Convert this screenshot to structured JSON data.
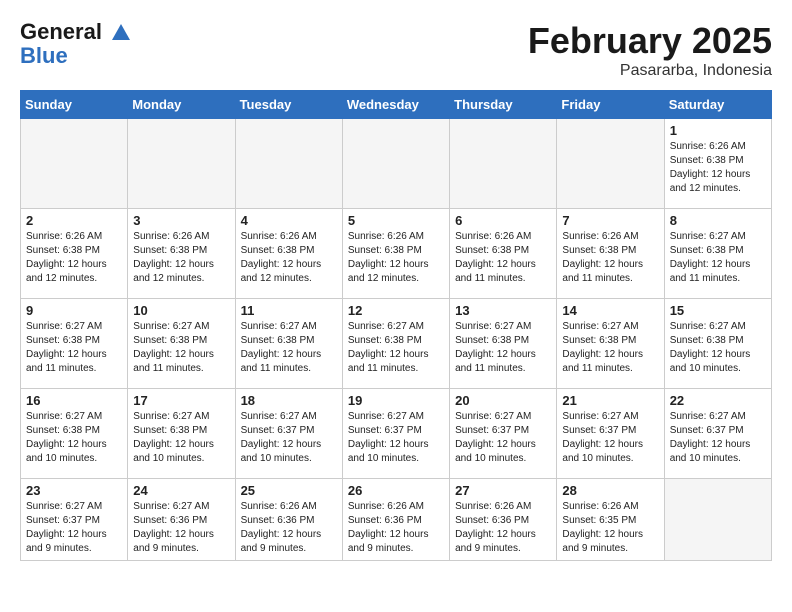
{
  "logo": {
    "line1": "General",
    "line2": "Blue"
  },
  "title": "February 2025",
  "subtitle": "Pasararba, Indonesia",
  "days_of_week": [
    "Sunday",
    "Monday",
    "Tuesday",
    "Wednesday",
    "Thursday",
    "Friday",
    "Saturday"
  ],
  "weeks": [
    [
      {
        "day": "",
        "info": ""
      },
      {
        "day": "",
        "info": ""
      },
      {
        "day": "",
        "info": ""
      },
      {
        "day": "",
        "info": ""
      },
      {
        "day": "",
        "info": ""
      },
      {
        "day": "",
        "info": ""
      },
      {
        "day": "1",
        "info": "Sunrise: 6:26 AM\nSunset: 6:38 PM\nDaylight: 12 hours\nand 12 minutes."
      }
    ],
    [
      {
        "day": "2",
        "info": "Sunrise: 6:26 AM\nSunset: 6:38 PM\nDaylight: 12 hours\nand 12 minutes."
      },
      {
        "day": "3",
        "info": "Sunrise: 6:26 AM\nSunset: 6:38 PM\nDaylight: 12 hours\nand 12 minutes."
      },
      {
        "day": "4",
        "info": "Sunrise: 6:26 AM\nSunset: 6:38 PM\nDaylight: 12 hours\nand 12 minutes."
      },
      {
        "day": "5",
        "info": "Sunrise: 6:26 AM\nSunset: 6:38 PM\nDaylight: 12 hours\nand 12 minutes."
      },
      {
        "day": "6",
        "info": "Sunrise: 6:26 AM\nSunset: 6:38 PM\nDaylight: 12 hours\nand 11 minutes."
      },
      {
        "day": "7",
        "info": "Sunrise: 6:26 AM\nSunset: 6:38 PM\nDaylight: 12 hours\nand 11 minutes."
      },
      {
        "day": "8",
        "info": "Sunrise: 6:27 AM\nSunset: 6:38 PM\nDaylight: 12 hours\nand 11 minutes."
      }
    ],
    [
      {
        "day": "9",
        "info": "Sunrise: 6:27 AM\nSunset: 6:38 PM\nDaylight: 12 hours\nand 11 minutes."
      },
      {
        "day": "10",
        "info": "Sunrise: 6:27 AM\nSunset: 6:38 PM\nDaylight: 12 hours\nand 11 minutes."
      },
      {
        "day": "11",
        "info": "Sunrise: 6:27 AM\nSunset: 6:38 PM\nDaylight: 12 hours\nand 11 minutes."
      },
      {
        "day": "12",
        "info": "Sunrise: 6:27 AM\nSunset: 6:38 PM\nDaylight: 12 hours\nand 11 minutes."
      },
      {
        "day": "13",
        "info": "Sunrise: 6:27 AM\nSunset: 6:38 PM\nDaylight: 12 hours\nand 11 minutes."
      },
      {
        "day": "14",
        "info": "Sunrise: 6:27 AM\nSunset: 6:38 PM\nDaylight: 12 hours\nand 11 minutes."
      },
      {
        "day": "15",
        "info": "Sunrise: 6:27 AM\nSunset: 6:38 PM\nDaylight: 12 hours\nand 10 minutes."
      }
    ],
    [
      {
        "day": "16",
        "info": "Sunrise: 6:27 AM\nSunset: 6:38 PM\nDaylight: 12 hours\nand 10 minutes."
      },
      {
        "day": "17",
        "info": "Sunrise: 6:27 AM\nSunset: 6:38 PM\nDaylight: 12 hours\nand 10 minutes."
      },
      {
        "day": "18",
        "info": "Sunrise: 6:27 AM\nSunset: 6:37 PM\nDaylight: 12 hours\nand 10 minutes."
      },
      {
        "day": "19",
        "info": "Sunrise: 6:27 AM\nSunset: 6:37 PM\nDaylight: 12 hours\nand 10 minutes."
      },
      {
        "day": "20",
        "info": "Sunrise: 6:27 AM\nSunset: 6:37 PM\nDaylight: 12 hours\nand 10 minutes."
      },
      {
        "day": "21",
        "info": "Sunrise: 6:27 AM\nSunset: 6:37 PM\nDaylight: 12 hours\nand 10 minutes."
      },
      {
        "day": "22",
        "info": "Sunrise: 6:27 AM\nSunset: 6:37 PM\nDaylight: 12 hours\nand 10 minutes."
      }
    ],
    [
      {
        "day": "23",
        "info": "Sunrise: 6:27 AM\nSunset: 6:37 PM\nDaylight: 12 hours\nand 9 minutes."
      },
      {
        "day": "24",
        "info": "Sunrise: 6:27 AM\nSunset: 6:36 PM\nDaylight: 12 hours\nand 9 minutes."
      },
      {
        "day": "25",
        "info": "Sunrise: 6:26 AM\nSunset: 6:36 PM\nDaylight: 12 hours\nand 9 minutes."
      },
      {
        "day": "26",
        "info": "Sunrise: 6:26 AM\nSunset: 6:36 PM\nDaylight: 12 hours\nand 9 minutes."
      },
      {
        "day": "27",
        "info": "Sunrise: 6:26 AM\nSunset: 6:36 PM\nDaylight: 12 hours\nand 9 minutes."
      },
      {
        "day": "28",
        "info": "Sunrise: 6:26 AM\nSunset: 6:35 PM\nDaylight: 12 hours\nand 9 minutes."
      },
      {
        "day": "",
        "info": ""
      }
    ]
  ]
}
